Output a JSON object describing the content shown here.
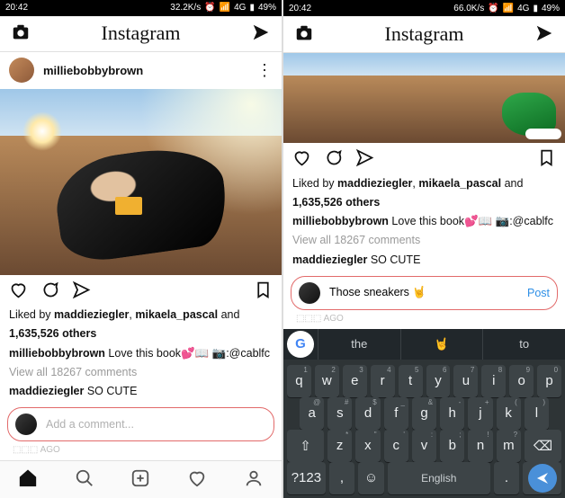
{
  "status": {
    "time": "20:42",
    "rate_left": "32.2K/s",
    "rate_right": "66.0K/s",
    "net": "4G",
    "battery": "49%"
  },
  "header": {
    "logo": "Instagram"
  },
  "post": {
    "username": "milliebobbybrown",
    "likes_line_prefix": "Liked by ",
    "liker1": "maddieziegler",
    "sep": ", ",
    "liker2": "mikaela_pascal",
    "and": " and",
    "likes_count": "1,635,526 others",
    "caption_user": "milliebobbybrown",
    "caption_text": " Love this book💕📖 📷:@cablfc",
    "view_comments": "View all 18267 comments",
    "top_comment_user": "maddieziegler",
    "top_comment_text": " SO CUTE",
    "time_ago": "⬚⬚⬚ AGO"
  },
  "comment_input": {
    "placeholder": "Add a comment...",
    "typed": "Those sneakers 🤘",
    "post_label": "Post"
  },
  "keyboard": {
    "sugg": [
      "the",
      "🤘",
      "to"
    ],
    "row1": [
      [
        "q",
        "1"
      ],
      [
        "w",
        "2"
      ],
      [
        "e",
        "3"
      ],
      [
        "r",
        "4"
      ],
      [
        "t",
        "5"
      ],
      [
        "y",
        "6"
      ],
      [
        "u",
        "7"
      ],
      [
        "i",
        "8"
      ],
      [
        "o",
        "9"
      ],
      [
        "p",
        "0"
      ]
    ],
    "row2": [
      [
        "a",
        "@"
      ],
      [
        "s",
        "#"
      ],
      [
        "d",
        "$"
      ],
      [
        "f",
        "_"
      ],
      [
        "g",
        "&"
      ],
      [
        "h",
        "-"
      ],
      [
        "j",
        "+"
      ],
      [
        "k",
        "("
      ],
      [
        "l",
        ")"
      ]
    ],
    "row3_letters": [
      [
        "z",
        "*"
      ],
      [
        "x",
        "\""
      ],
      [
        "c",
        "'"
      ],
      [
        "v",
        ":"
      ],
      [
        "b",
        ";"
      ],
      [
        "n",
        "!"
      ],
      [
        "m",
        "?"
      ]
    ],
    "symkey": "?123",
    "langkey": "English"
  }
}
